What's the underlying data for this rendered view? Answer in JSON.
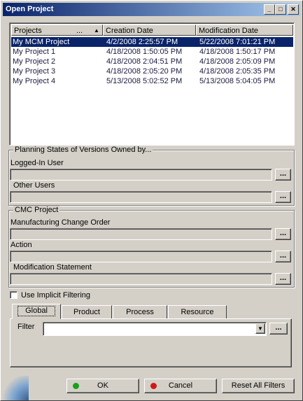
{
  "window": {
    "title": "Open Project"
  },
  "title_buttons": {
    "minimize": "_",
    "maximize": "□",
    "close": "✕"
  },
  "projects_table": {
    "columns": [
      "Projects",
      "...",
      "Creation Date",
      "Modification Date"
    ],
    "rows": [
      {
        "name": "My MCM Project",
        "created": "4/2/2008 2:25:57 PM",
        "modified": "5/22/2008 7:01:21 PM",
        "selected": true
      },
      {
        "name": "My Project 1",
        "created": "4/18/2008 1:50:05 PM",
        "modified": "4/18/2008 1:50:17 PM"
      },
      {
        "name": "My Project 2",
        "created": "4/18/2008 2:04:51 PM",
        "modified": "4/18/2008 2:05:09 PM"
      },
      {
        "name": "My Project 3",
        "created": "4/18/2008 2:05:20 PM",
        "modified": "4/18/2008 2:05:35 PM"
      },
      {
        "name": "My Project 4",
        "created": "5/13/2008 5:02:52 PM",
        "modified": "5/13/2008 5:04:05 PM"
      }
    ]
  },
  "planning_states": {
    "title": "Planning States of Versions Owned by...",
    "logged_in_label": "Logged-In User",
    "logged_in_value": "",
    "other_users_label": "Other Users",
    "other_users_value": ""
  },
  "cmc_project": {
    "title": "CMC Project",
    "mco_label": "Manufacturing Change Order",
    "mco_value": "",
    "action_label": "Action",
    "action_value": "",
    "mod_statement_label": "Modification Statement",
    "mod_statement_value": ""
  },
  "ellipsis": "...",
  "implicit_filtering": {
    "label": "Use Implicit Filtering",
    "checked": false
  },
  "tabs": [
    "Global",
    "Product",
    "Process",
    "Resource"
  ],
  "active_tab": "Global",
  "filter": {
    "label": "Filter",
    "value": ""
  },
  "buttons": {
    "ok": "OK",
    "cancel": "Cancel",
    "reset": "Reset All Filters"
  },
  "colors": {
    "selection": "#0a246a",
    "ok_icon": "#1aa11a",
    "cancel_icon": "#d01818"
  }
}
